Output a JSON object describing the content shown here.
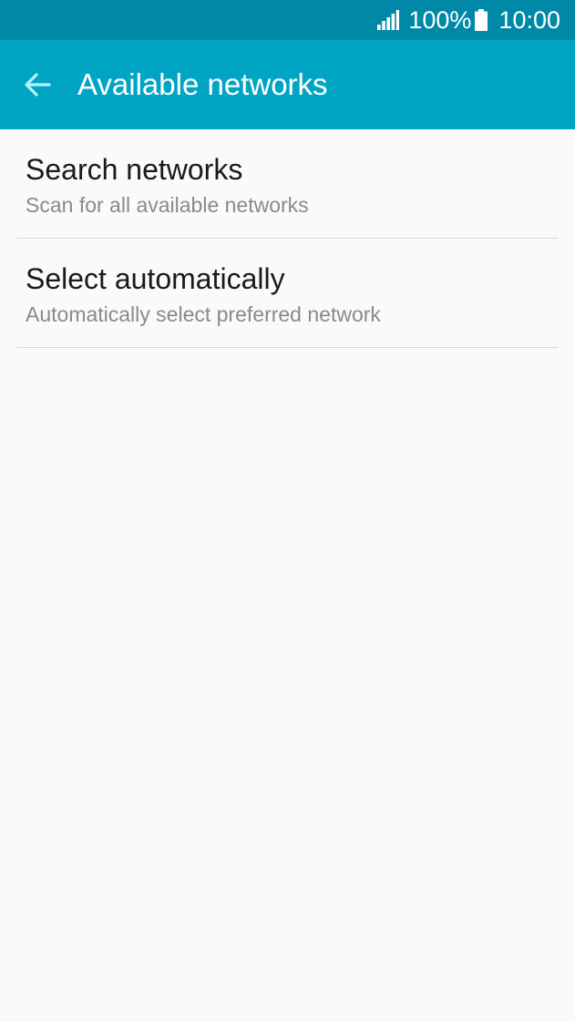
{
  "status_bar": {
    "battery_percent": "100%",
    "time": "10:00",
    "icons": [
      "signal-icon",
      "battery-icon"
    ]
  },
  "app_bar": {
    "title": "Available networks",
    "back_icon": "back-arrow-icon"
  },
  "list": {
    "items": [
      {
        "title": "Search networks",
        "subtitle": "Scan for all available networks"
      },
      {
        "title": "Select automatically",
        "subtitle": "Automatically select preferred network"
      }
    ]
  },
  "colors": {
    "status_bar": "#0089a7",
    "app_bar": "#00a5c4",
    "back_arrow": "#b7f3ff",
    "background": "#fafafa"
  }
}
